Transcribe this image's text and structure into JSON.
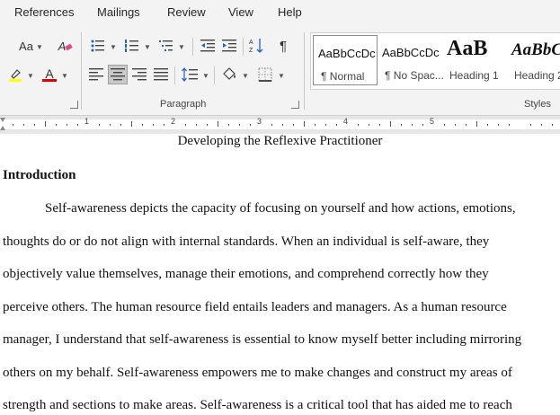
{
  "ribbon": {
    "tabs": [
      "References",
      "Mailings",
      "Review",
      "View",
      "Help"
    ],
    "font_group": {
      "font_size_label": "Aa",
      "clear_format_label": "A",
      "font_color_label": "A",
      "highlight_color": "#ffff00",
      "font_color": "#e00000"
    },
    "paragraph_group": {
      "label": "Paragraph",
      "show_marks_glyph": "¶"
    },
    "styles_group": {
      "label": "Styles",
      "items": [
        {
          "sample": "AaBbCcDc",
          "name": "¶ Normal"
        },
        {
          "sample": "AaBbCcDc",
          "name": "¶ No Spac..."
        },
        {
          "sample": "AaB",
          "name": "Heading 1"
        },
        {
          "sample": "AaBbC",
          "name": "Heading 2"
        }
      ]
    }
  },
  "ruler": {
    "numbers": [
      "1",
      "2",
      "3",
      "4",
      "5"
    ]
  },
  "document": {
    "title": "Developing the Reflexive Practitioner",
    "heading": "Introduction",
    "lines": [
      "Self-awareness depicts the capacity of focusing on yourself and how actions, emotions,",
      "thoughts do or do not align with internal standards. When an individual is self-aware, they",
      "objectively value themselves, manage their emotions, and comprehend correctly how they",
      "perceive others. The human resource field entails leaders and managers. As a human resource",
      "manager, I understand that self-awareness is essential to know myself better including mirroring",
      "others on my behalf. Self-awareness empowers me to make changes and construct my areas of",
      "strength and sections to make areas.  Self-awareness is a critical tool that has aided me to reach"
    ]
  }
}
